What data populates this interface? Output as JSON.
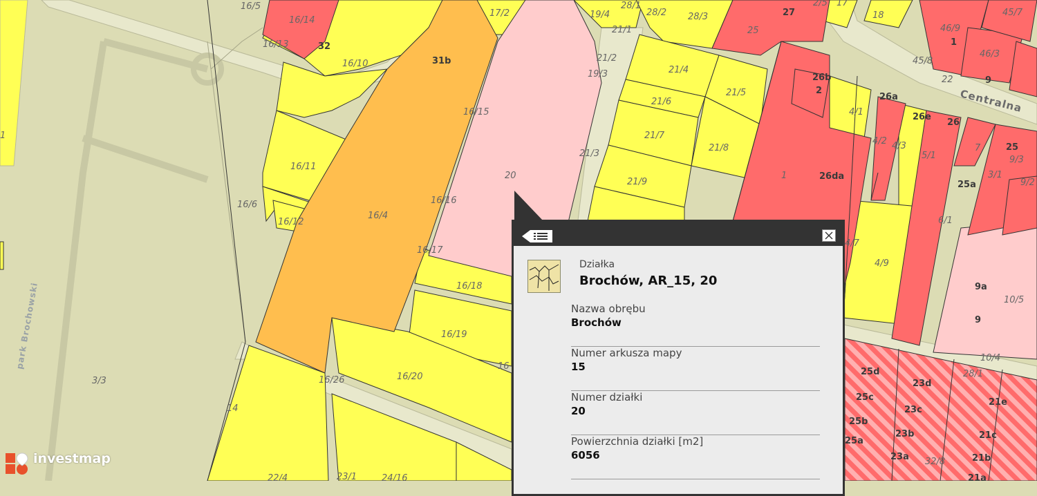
{
  "colors": {
    "base": "#dcdcb4",
    "yellow": "#ffff55",
    "orange": "#ffbe4e",
    "pink": "#ffcccc",
    "red": "#ff6b6b",
    "road": "#e6e6c6",
    "popup_dark": "#333333",
    "popup_bg": "#ececec"
  },
  "map": {
    "streets": [
      {
        "id": "centralna",
        "label": "Centralna"
      },
      {
        "id": "park",
        "label": "park Brochowski"
      }
    ],
    "plots": [
      {
        "id": "p165",
        "label": "16/5"
      },
      {
        "id": "p1614",
        "label": "16/14"
      },
      {
        "id": "p1613",
        "label": "16/13"
      },
      {
        "id": "p1610",
        "label": "16/10"
      },
      {
        "id": "p172",
        "label": "17/2"
      },
      {
        "id": "p194",
        "label": "19/4"
      },
      {
        "id": "p281",
        "label": "28/1"
      },
      {
        "id": "p282",
        "label": "28/2"
      },
      {
        "id": "p283",
        "label": "28/3"
      },
      {
        "id": "p211",
        "label": "21/1"
      },
      {
        "id": "p212",
        "label": "21/2"
      },
      {
        "id": "p193",
        "label": "19/3"
      },
      {
        "id": "p214",
        "label": "21/4"
      },
      {
        "id": "p215",
        "label": "21/5"
      },
      {
        "id": "p216",
        "label": "21/6"
      },
      {
        "id": "p217",
        "label": "21/7"
      },
      {
        "id": "p218",
        "label": "21/8"
      },
      {
        "id": "p219",
        "label": "21/9"
      },
      {
        "id": "p213",
        "label": "21/3"
      },
      {
        "id": "p1615",
        "label": "16/15"
      },
      {
        "id": "p20",
        "label": "20"
      },
      {
        "id": "p1611",
        "label": "16/11"
      },
      {
        "id": "p166",
        "label": "16/6"
      },
      {
        "id": "p1612",
        "label": "16/12"
      },
      {
        "id": "p164",
        "label": "16/4"
      },
      {
        "id": "p1616",
        "label": "16/16"
      },
      {
        "id": "p1617",
        "label": "16/17"
      },
      {
        "id": "p1618",
        "label": "16/18"
      },
      {
        "id": "p1619",
        "label": "16/19"
      },
      {
        "id": "p1620",
        "label": "16/20"
      },
      {
        "id": "p1626",
        "label": "16/26"
      },
      {
        "id": "p16x",
        "label": "16"
      },
      {
        "id": "p33",
        "label": "3/3"
      },
      {
        "id": "p14",
        "label": "14"
      },
      {
        "id": "p224",
        "label": "22/4"
      },
      {
        "id": "p231",
        "label": "23/1"
      },
      {
        "id": "p2416",
        "label": "24/16"
      },
      {
        "id": "p25",
        "label": "25"
      },
      {
        "id": "p25b",
        "label": "2/5"
      },
      {
        "id": "p17",
        "label": "17"
      },
      {
        "id": "p18",
        "label": "18"
      },
      {
        "id": "p458",
        "label": "45/8"
      },
      {
        "id": "p22",
        "label": "22"
      },
      {
        "id": "p41",
        "label": "4/1"
      },
      {
        "id": "p42",
        "label": "4/2"
      },
      {
        "id": "p43",
        "label": "4/3"
      },
      {
        "id": "p51",
        "label": "5/1"
      },
      {
        "id": "p7",
        "label": "7"
      },
      {
        "id": "p31",
        "label": "3/1"
      },
      {
        "id": "p93",
        "label": "9/3"
      },
      {
        "id": "p92",
        "label": "9/2"
      },
      {
        "id": "p61",
        "label": "6/1"
      },
      {
        "id": "p1",
        "label": "1"
      },
      {
        "id": "p47",
        "label": "4/7"
      },
      {
        "id": "p49",
        "label": "4/9"
      },
      {
        "id": "p105",
        "label": "10/5"
      },
      {
        "id": "p104",
        "label": "10/4"
      },
      {
        "id": "p281b",
        "label": "28/1"
      },
      {
        "id": "p328",
        "label": "32/8"
      },
      {
        "id": "p469",
        "label": "46/9"
      },
      {
        "id": "p463",
        "label": "46/3"
      },
      {
        "id": "p457",
        "label": "45/7"
      },
      {
        "id": "p1left",
        "label": "1"
      }
    ],
    "addresses": [
      {
        "id": "a32",
        "label": "32"
      },
      {
        "id": "a31b",
        "label": "31b"
      },
      {
        "id": "a27",
        "label": "27"
      },
      {
        "id": "a26b",
        "label": "26b"
      },
      {
        "id": "a2",
        "label": "2"
      },
      {
        "id": "a26a",
        "label": "26a"
      },
      {
        "id": "a26e",
        "label": "26e"
      },
      {
        "id": "a26",
        "label": "26"
      },
      {
        "id": "a26da",
        "label": "26da"
      },
      {
        "id": "a25",
        "label": "25"
      },
      {
        "id": "a25a",
        "label": "25a"
      },
      {
        "id": "a1",
        "label": "1"
      },
      {
        "id": "a9",
        "label": "9"
      },
      {
        "id": "a9a",
        "label": "9a"
      },
      {
        "id": "a9b",
        "label": "9"
      },
      {
        "id": "a25d",
        "label": "25d"
      },
      {
        "id": "a23d",
        "label": "23d"
      },
      {
        "id": "a25c",
        "label": "25c"
      },
      {
        "id": "a23c",
        "label": "23c"
      },
      {
        "id": "a21e",
        "label": "21e"
      },
      {
        "id": "a25b",
        "label": "25b"
      },
      {
        "id": "a23b",
        "label": "23b"
      },
      {
        "id": "a21c",
        "label": "21c"
      },
      {
        "id": "a25a2",
        "label": "25a"
      },
      {
        "id": "a23a",
        "label": "23a"
      },
      {
        "id": "a21b",
        "label": "21b"
      },
      {
        "id": "a21a",
        "label": "21a"
      }
    ]
  },
  "popup": {
    "feature_type": "Działka",
    "feature_title": "Brochów, AR_15, 20",
    "attributes": [
      {
        "label": "Nazwa obrębu",
        "value": "Brochów"
      },
      {
        "label": "Numer arkusza mapy",
        "value": "15"
      },
      {
        "label": "Numer działki",
        "value": "20"
      },
      {
        "label": "Powierzchnia działki [m2]",
        "value": "6056"
      }
    ]
  },
  "brand": {
    "name": "investmap"
  }
}
